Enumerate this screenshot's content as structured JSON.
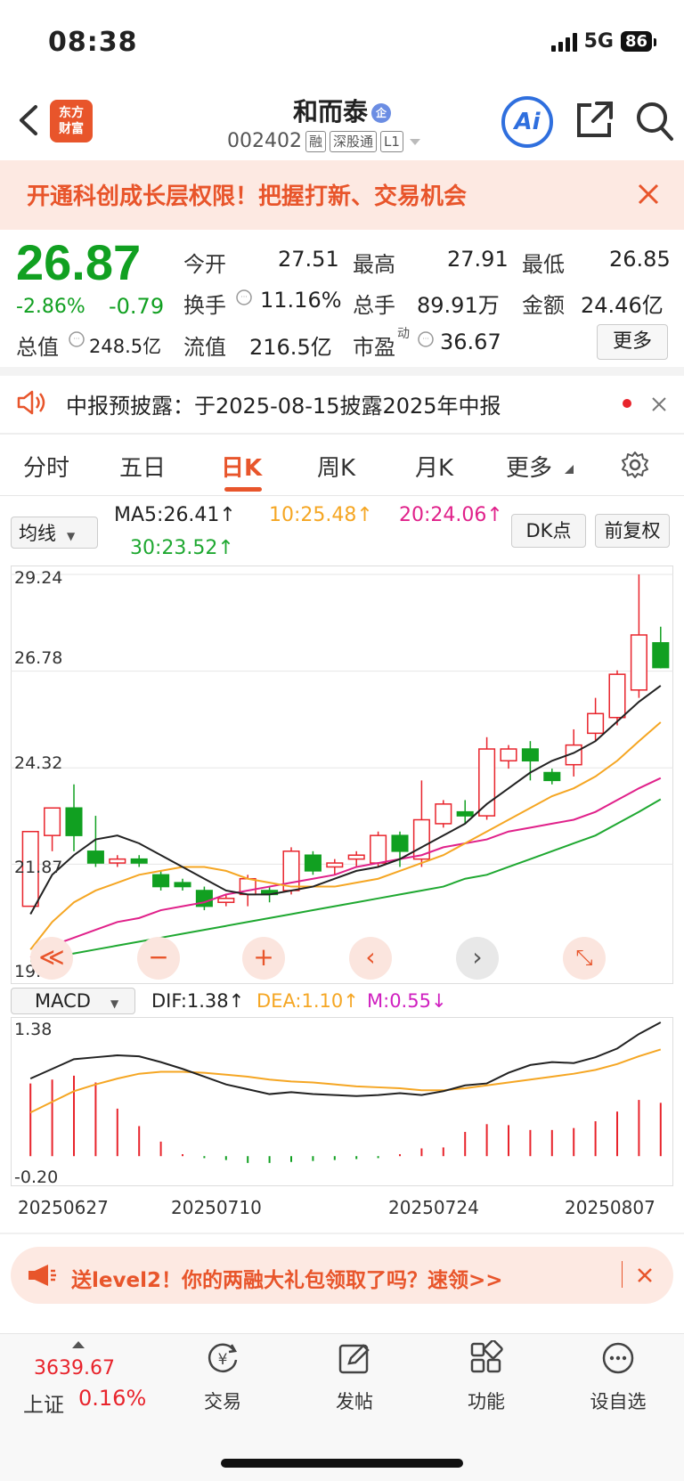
{
  "status": {
    "time": "08:38",
    "network": "5G",
    "battery": "86"
  },
  "header": {
    "logo_text_1": "东方",
    "logo_text_2": "财富",
    "title": "和而泰",
    "title_badge": "企",
    "code": "002402",
    "tags": [
      "融",
      "深股通",
      "L1"
    ],
    "ai_label": "Ai"
  },
  "banner": {
    "text": "开通科创成长层权限！把握打新、交易机会"
  },
  "quote": {
    "price": "26.87",
    "change_pct": "-2.86%",
    "change_abs": "-0.79",
    "open_label": "今开",
    "open": "27.51",
    "high_label": "最高",
    "high": "27.91",
    "low_label": "最低",
    "low": "26.85",
    "turnover_label": "换手",
    "turnover": "11.16%",
    "volume_label": "总手",
    "volume": "89.91万",
    "amount_label": "金额",
    "amount": "24.46亿",
    "mcap_label": "总值",
    "mcap": "248.5亿",
    "float_label": "流值",
    "float": "216.5亿",
    "pe_label": "市盈",
    "pe_sup": "动",
    "pe": "36.67",
    "more_label": "更多"
  },
  "notice": {
    "text": "中报预披露：于2025-08-15披露2025年中报"
  },
  "tabs": [
    "分时",
    "五日",
    "日K",
    "周K",
    "月K",
    "更多"
  ],
  "active_tab": "日K",
  "ma": {
    "selector": "均线",
    "ma5": "MA5:26.41↑",
    "ma10": "10:25.48↑",
    "ma20": "20:24.06↑",
    "ma30": "30:23.52↑",
    "dk_label": "DK点",
    "adjust_label": "前复权"
  },
  "chart_axis": {
    "y_top": "29.24",
    "y2": "26.78",
    "y3": "24.32",
    "y4": "21.87",
    "y_bottom": "19.41"
  },
  "chart_controls": [
    "≪",
    "−",
    "+",
    "‹",
    "›",
    "⤡"
  ],
  "macd": {
    "selector": "MACD",
    "dif": "DIF:1.38↑",
    "dea": "DEA:1.10↑",
    "m": "M:0.55↓",
    "y_top": "1.38",
    "y_bottom": "-0.20"
  },
  "dates": [
    "20250627",
    "20250710",
    "20250724",
    "20250807"
  ],
  "colors": {
    "up": "#e8242c",
    "down": "#11a021",
    "accent": "#e8552b",
    "ma5": "#222222",
    "ma10": "#f5a623",
    "ma20": "#e0218a",
    "ma30": "#1fa831"
  },
  "chart_data": {
    "type": "candlestick",
    "ylim": [
      19.41,
      29.24
    ],
    "candles": [
      {
        "o": 20.8,
        "c": 22.7,
        "h": 22.7,
        "l": 20.8
      },
      {
        "o": 22.6,
        "c": 23.3,
        "h": 23.3,
        "l": 22.2
      },
      {
        "o": 23.3,
        "c": 22.6,
        "h": 23.9,
        "l": 22.2
      },
      {
        "o": 22.2,
        "c": 21.9,
        "h": 23.1,
        "l": 21.8
      },
      {
        "o": 21.9,
        "c": 22.0,
        "h": 22.1,
        "l": 21.8
      },
      {
        "o": 22.0,
        "c": 21.9,
        "h": 22.1,
        "l": 21.8
      },
      {
        "o": 21.6,
        "c": 21.3,
        "h": 21.7,
        "l": 21.2
      },
      {
        "o": 21.4,
        "c": 21.3,
        "h": 21.5,
        "l": 21.2
      },
      {
        "o": 21.2,
        "c": 20.8,
        "h": 21.3,
        "l": 20.7
      },
      {
        "o": 20.9,
        "c": 21.0,
        "h": 21.1,
        "l": 20.8
      },
      {
        "o": 21.1,
        "c": 21.5,
        "h": 21.6,
        "l": 20.8
      },
      {
        "o": 21.2,
        "c": 21.1,
        "h": 21.3,
        "l": 20.9
      },
      {
        "o": 21.2,
        "c": 22.2,
        "h": 22.3,
        "l": 21.1
      },
      {
        "o": 22.1,
        "c": 21.7,
        "h": 22.2,
        "l": 21.6
      },
      {
        "o": 21.8,
        "c": 21.9,
        "h": 22.0,
        "l": 21.6
      },
      {
        "o": 22.0,
        "c": 22.1,
        "h": 22.2,
        "l": 21.8
      },
      {
        "o": 21.9,
        "c": 22.6,
        "h": 22.7,
        "l": 21.8
      },
      {
        "o": 22.6,
        "c": 22.2,
        "h": 22.7,
        "l": 21.8
      },
      {
        "o": 22.0,
        "c": 23.0,
        "h": 24.0,
        "l": 21.8
      },
      {
        "o": 22.9,
        "c": 23.4,
        "h": 23.5,
        "l": 22.8
      },
      {
        "o": 23.2,
        "c": 23.1,
        "h": 23.5,
        "l": 22.9
      },
      {
        "o": 23.1,
        "c": 24.8,
        "h": 25.1,
        "l": 23.0
      },
      {
        "o": 24.5,
        "c": 24.8,
        "h": 24.9,
        "l": 24.3
      },
      {
        "o": 24.8,
        "c": 24.5,
        "h": 25.0,
        "l": 24.0
      },
      {
        "o": 24.2,
        "c": 24.0,
        "h": 24.3,
        "l": 23.9
      },
      {
        "o": 24.4,
        "c": 24.9,
        "h": 25.3,
        "l": 24.1
      },
      {
        "o": 25.2,
        "c": 25.7,
        "h": 26.1,
        "l": 25.0
      },
      {
        "o": 25.6,
        "c": 26.7,
        "h": 26.8,
        "l": 25.4
      },
      {
        "o": 26.3,
        "c": 27.7,
        "h": 29.24,
        "l": 26.1
      },
      {
        "o": 27.5,
        "c": 26.87,
        "h": 27.91,
        "l": 26.85
      }
    ],
    "ma5": [
      20.6,
      21.6,
      22.1,
      22.5,
      22.6,
      22.4,
      22.1,
      21.8,
      21.5,
      21.2,
      21.1,
      21.1,
      21.2,
      21.3,
      21.5,
      21.7,
      21.8,
      22.0,
      22.3,
      22.6,
      22.9,
      23.4,
      23.8,
      24.2,
      24.5,
      24.7,
      25.0,
      25.5,
      26.0,
      26.41
    ],
    "ma10": [
      19.7,
      20.4,
      20.9,
      21.2,
      21.4,
      21.6,
      21.7,
      21.8,
      21.8,
      21.7,
      21.5,
      21.4,
      21.3,
      21.3,
      21.3,
      21.4,
      21.5,
      21.7,
      21.9,
      22.1,
      22.4,
      22.7,
      23.0,
      23.3,
      23.6,
      23.8,
      24.1,
      24.5,
      25.0,
      25.48
    ],
    "ma20": [
      19.5,
      19.8,
      20.0,
      20.2,
      20.4,
      20.5,
      20.7,
      20.8,
      20.9,
      21.1,
      21.2,
      21.3,
      21.4,
      21.5,
      21.6,
      21.8,
      21.9,
      22.0,
      22.1,
      22.3,
      22.4,
      22.5,
      22.7,
      22.8,
      22.9,
      23.0,
      23.2,
      23.5,
      23.8,
      24.06
    ],
    "ma30": [
      19.4,
      19.5,
      19.6,
      19.7,
      19.8,
      19.9,
      20.0,
      20.1,
      20.2,
      20.3,
      20.4,
      20.5,
      20.6,
      20.7,
      20.8,
      20.9,
      21.0,
      21.1,
      21.2,
      21.3,
      21.5,
      21.6,
      21.8,
      22.0,
      22.2,
      22.4,
      22.6,
      22.9,
      23.2,
      23.52
    ],
    "macd_ylim": [
      -0.2,
      1.38
    ],
    "dif": [
      0.8,
      0.9,
      1.0,
      1.02,
      1.04,
      1.03,
      0.97,
      0.9,
      0.82,
      0.74,
      0.69,
      0.64,
      0.66,
      0.64,
      0.63,
      0.62,
      0.63,
      0.65,
      0.63,
      0.67,
      0.73,
      0.75,
      0.86,
      0.94,
      0.97,
      0.96,
      1.02,
      1.11,
      1.26,
      1.38
    ],
    "dea": [
      0.45,
      0.56,
      0.67,
      0.74,
      0.8,
      0.85,
      0.87,
      0.87,
      0.86,
      0.84,
      0.82,
      0.79,
      0.77,
      0.76,
      0.74,
      0.72,
      0.71,
      0.7,
      0.68,
      0.68,
      0.7,
      0.73,
      0.76,
      0.79,
      0.82,
      0.85,
      0.89,
      0.95,
      1.03,
      1.1
    ],
    "m": [
      0.75,
      0.79,
      0.83,
      0.76,
      0.49,
      0.31,
      0.15,
      0.02,
      -0.02,
      -0.04,
      -0.07,
      -0.07,
      -0.06,
      -0.05,
      -0.04,
      -0.03,
      -0.02,
      0.02,
      0.08,
      0.09,
      0.25,
      0.33,
      0.32,
      0.27,
      0.27,
      0.29,
      0.36,
      0.46,
      0.58,
      0.55
    ]
  }
}
